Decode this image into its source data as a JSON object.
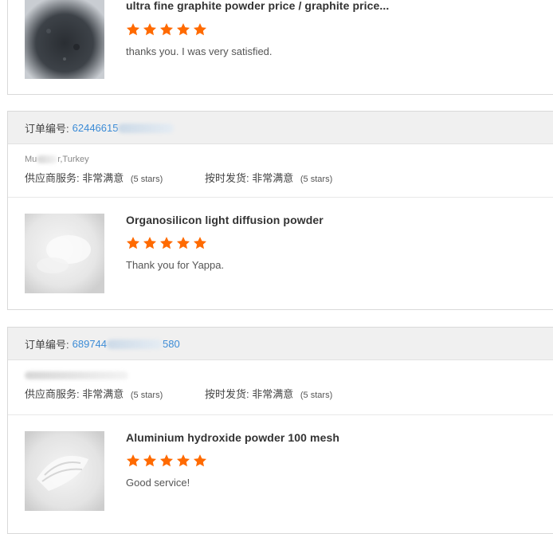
{
  "colors": {
    "star": "#ff6a00",
    "link": "#3b8bd6",
    "header_bg": "#f0f0f0"
  },
  "reviews": [
    {
      "product_title": "ultra fine graphite powder price / graphite price...",
      "stars": 5,
      "comment": "thanks you.  I was very satisfied.",
      "image": "graphite-powder"
    },
    {
      "order_label": "订单编号:",
      "order_number": "62446615",
      "buyer": "Mu",
      "buyer_location": "r,Turkey",
      "supplier_label": "供应商服务:",
      "supplier_value": "非常满意",
      "supplier_stars": "(5 stars)",
      "shipping_label": "按时发货:",
      "shipping_value": "非常满意",
      "shipping_stars": "(5 stars)",
      "product_title": "Organosilicon light diffusion powder",
      "stars": 5,
      "comment": "Thank you for Yappa.",
      "image": "white-powder"
    },
    {
      "order_label": "订单编号:",
      "order_number": "689744",
      "order_number_tail": "580",
      "supplier_label": "供应商服务:",
      "supplier_value": "非常满意",
      "supplier_stars": "(5 stars)",
      "shipping_label": "按时发货:",
      "shipping_value": "非常满意",
      "shipping_stars": "(5 stars)",
      "product_title": "Aluminium hydroxide powder 100 mesh",
      "stars": 5,
      "comment": "Good service!",
      "image": "white-powder"
    }
  ]
}
